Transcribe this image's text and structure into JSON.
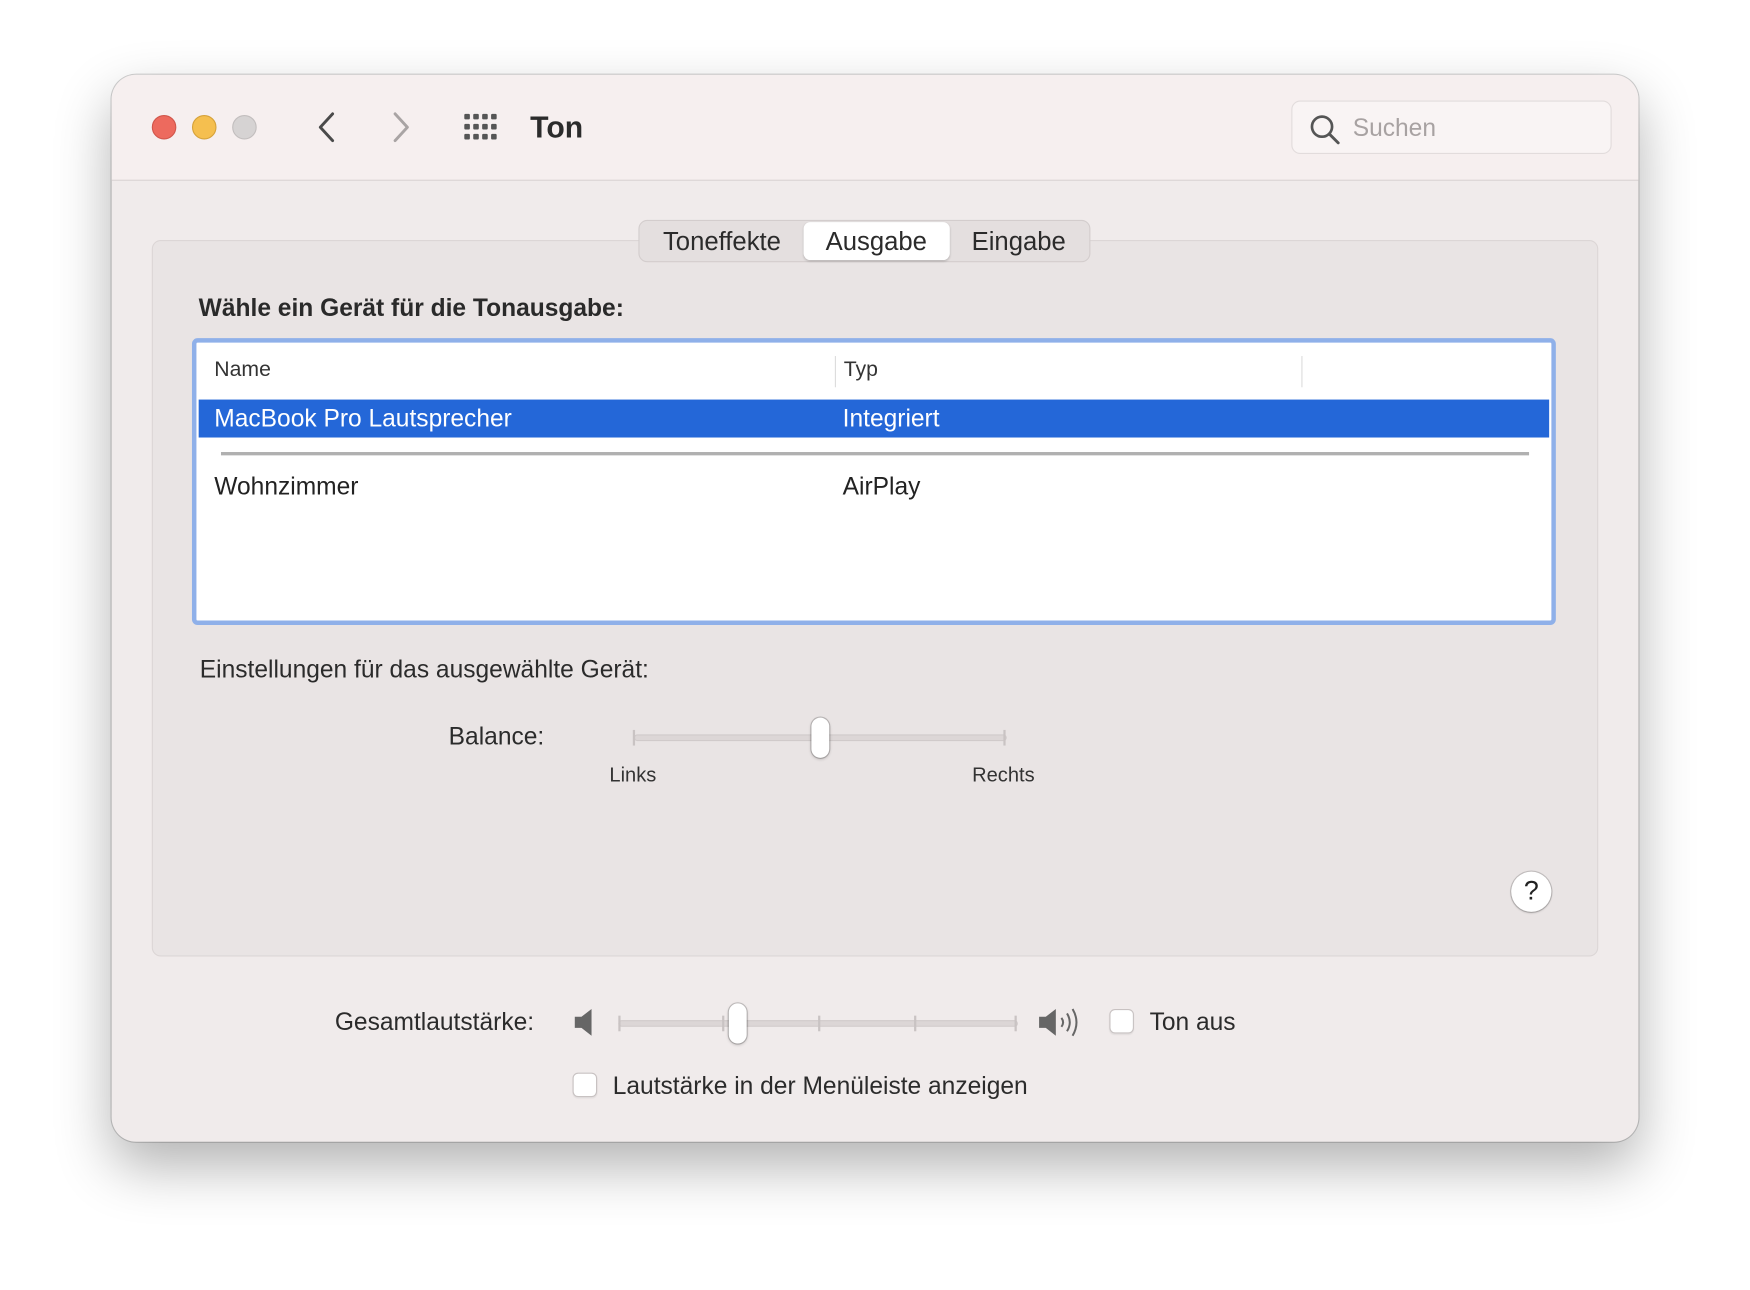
{
  "window": {
    "title": "Ton"
  },
  "toolbar": {
    "back_icon": "chevron-left-icon",
    "forward_icon": "chevron-right-icon",
    "grid_icon": "grid-icon"
  },
  "search": {
    "placeholder": "Suchen",
    "value": ""
  },
  "tabs": [
    {
      "label": "Toneffekte",
      "active": false
    },
    {
      "label": "Ausgabe",
      "active": true
    },
    {
      "label": "Eingabe",
      "active": false
    }
  ],
  "output": {
    "heading": "Wähle ein Gerät für die Tonausgabe:",
    "columns": {
      "name": "Name",
      "type": "Typ"
    },
    "devices": [
      {
        "name": "MacBook Pro Lautsprecher",
        "type": "Integriert",
        "selected": true
      },
      {
        "name": "Wohnzimmer",
        "type": "AirPlay",
        "selected": false
      }
    ]
  },
  "device_settings": {
    "heading": "Einstellungen für das ausgewählte Gerät:",
    "balance": {
      "label": "Balance:",
      "left_label": "Links",
      "right_label": "Rechts",
      "value": 0.5
    }
  },
  "help": {
    "label": "?"
  },
  "volume": {
    "label": "Gesamtlautstärke:",
    "level": 0.3,
    "mute_label": "Ton aus",
    "mute_checked": false,
    "menubar_label": "Lautstärke in der Menüleiste anzeigen",
    "menubar_checked": false
  },
  "colors": {
    "selection": "#2467d8",
    "focus_ring": "#8fb0e9",
    "close": "#ed6a5e",
    "minimize": "#f5bf4f",
    "zoom": "#d6d3d3"
  }
}
